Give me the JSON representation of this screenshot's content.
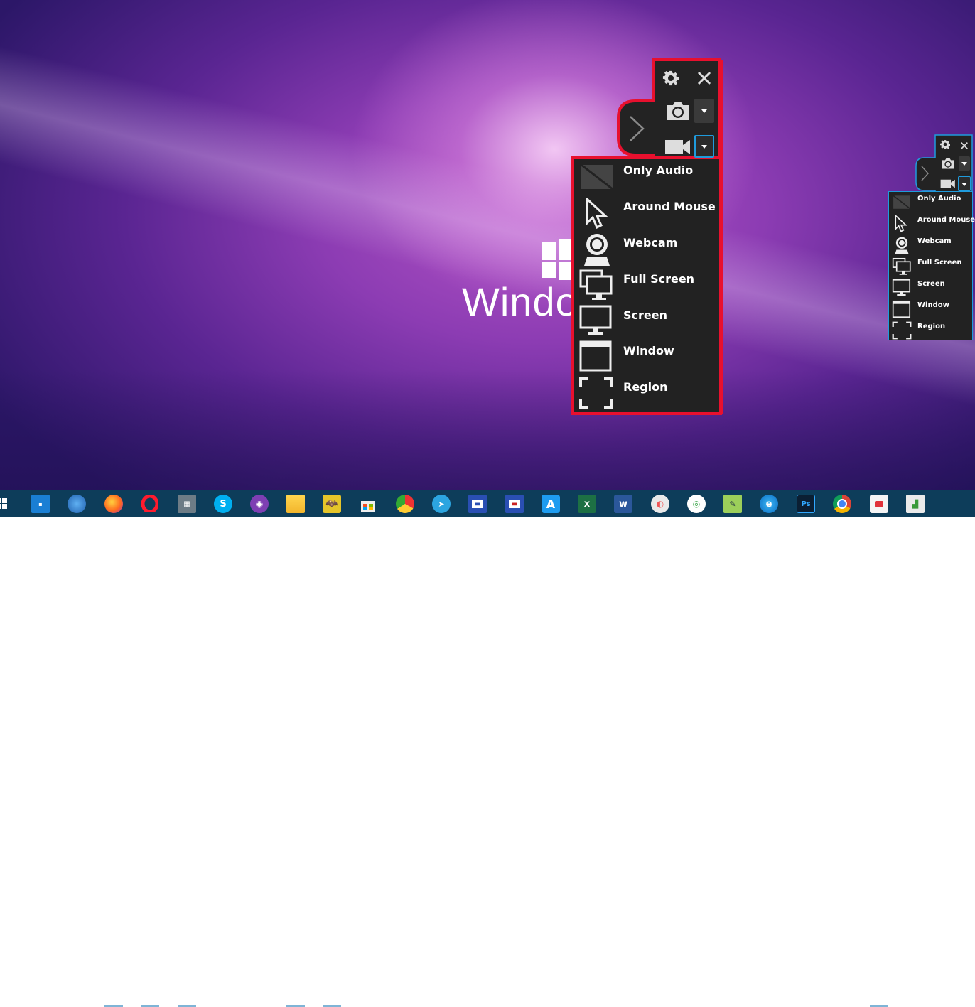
{
  "wallpaper": {
    "text": "Windo"
  },
  "recorder_toolbar": {
    "menu_items": [
      {
        "label": "Only Audio",
        "icon": "no-video-icon"
      },
      {
        "label": "Around Mouse",
        "icon": "mouse-pointer-icon"
      },
      {
        "label": "Webcam",
        "icon": "webcam-icon"
      },
      {
        "label": "Full Screen",
        "icon": "multi-monitor-icon"
      },
      {
        "label": "Screen",
        "icon": "monitor-icon"
      },
      {
        "label": "Window",
        "icon": "window-icon"
      },
      {
        "label": "Region",
        "icon": "region-icon"
      }
    ],
    "highlight_color": "#e8102e",
    "selection_color": "#1f9bdc"
  },
  "taskbar": {
    "apps": [
      "start",
      "task-view",
      "thunderbird",
      "firefox",
      "opera",
      "calculator",
      "skype",
      "tor-browser",
      "file-explorer",
      "batman-game",
      "store",
      "chrome-canary",
      "telegram",
      "floppy-save-1",
      "floppy-save-2",
      "app-store",
      "excel",
      "word",
      "paint-app",
      "green-app",
      "notepad-plus",
      "edge",
      "photoshop",
      "chrome",
      "screen-recorder",
      "network-monitor"
    ],
    "labels": {
      "excel": "x",
      "word": "w",
      "photoshop": "Ps",
      "skype": "S",
      "app-store": "A"
    }
  },
  "colors": {
    "toolbar_bg": "#232323",
    "taskbar_bg": "#0d3d5a"
  }
}
